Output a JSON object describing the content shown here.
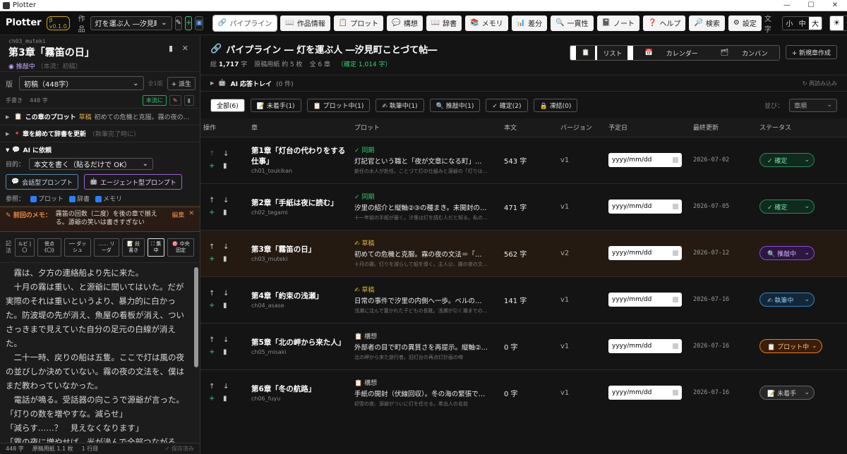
{
  "window": {
    "title": "Plotter",
    "min": "—",
    "max": "☐",
    "close": "✕"
  },
  "topbar": {
    "logo": "Plotter",
    "version": "β v0.1.0",
    "work_label": "作品",
    "work_value": "灯を運ぶ人 ―汐見町こ…",
    "tabs": [
      {
        "icon": "🔗",
        "label": "パイプライン"
      },
      {
        "icon": "📖",
        "label": "作品情報"
      },
      {
        "icon": "📋",
        "label": "プロット"
      },
      {
        "icon": "💬",
        "label": "構想"
      },
      {
        "icon": "📖",
        "label": "辞書"
      },
      {
        "icon": "📚",
        "label": "メモリ"
      },
      {
        "icon": "📊",
        "label": "差分"
      },
      {
        "icon": "🔍",
        "label": "一貫性"
      },
      {
        "icon": "📓",
        "label": "ノート"
      },
      {
        "icon": "❓",
        "label": "ヘルプ"
      },
      {
        "icon": "🔎",
        "label": "検索"
      },
      {
        "icon": "⚙",
        "label": "設定"
      }
    ],
    "font_label": "文字",
    "font_sizes": [
      "小",
      "中",
      "大"
    ]
  },
  "left": {
    "slug": "ch03_muteki",
    "title": "第3章「霧笛の日」",
    "status": "推敲中",
    "status_sub": "（本流：初稿）",
    "version_label": "版",
    "version_value": "初稿（448字）",
    "version_count": "全1版",
    "fork_button": "+ 派生",
    "wc_label": "手書き",
    "wc_value": "448 字",
    "mainline_button": "本流に",
    "plot_section": {
      "label": "この章のプロット",
      "state": "草稿",
      "desc": "初めての危機と克服。霧の夜の文…"
    },
    "dict_section": {
      "label": "章を締めて辞書を更新",
      "note": "（執筆完了時に）"
    },
    "ai": {
      "title": "AI に依頼",
      "purpose_label": "目的：",
      "purpose_value": "本文を書く（貼るだけで OK）",
      "chat_prompt": "会話型プロンプト",
      "agent_prompt": "エージェント型プロンプト",
      "refs_label": "参照：",
      "refs": [
        "プロット",
        "辞書",
        "メモリ"
      ]
    },
    "memo": {
      "label": "前回のメモ：",
      "text": "霧笛の回数（二度）を後の章で揃える。源爺の笑いは書きすぎない",
      "edit": "編集"
    },
    "tools": {
      "label": "記法",
      "buttons": [
        "ルビ |〇",
        "傍点《〇》",
        "── ダッシュ",
        "…… リーダ",
        "📝 段書き",
        "⛶ 集中",
        "🎯 中央固定"
      ]
    },
    "editor_lines": [
      "　霧は、夕方の連絡船より先に来た。",
      "　十月の霧は重い、と源爺に聞いてはいた。だが実際のそれは重いというより、暴力的に白かった。防波堤の先が消え、魚屋の看板が消え、ついさっきまで見えていた自分の足元の白線が消えた。",
      "　二十一時、戻りの船は五隻。ここで灯は風の夜の並びしか決めていない。霧の夜の文法を、僕はまだ教わっていなかった。",
      "　電話が鳴る。受話器の向こうで源爺が言った。",
      "「灯りの数を増やすな。減らせ」",
      "「減らす……？　見えなくなります」",
      "「霧の夜に増やせば、光が滲んで全部つながる。文章が読め"
    ],
    "footer": {
      "chars": "448 字",
      "paper": "原稿用紙 1.1 枚",
      "line": "1 行目",
      "saved": "✓ 保存済み"
    }
  },
  "pipeline": {
    "title": "パイプライン ― 灯を運ぶ人 ―汐見町ことづて帖―",
    "total_label": "総",
    "total_value": "1,717",
    "total_unit": "字",
    "paper": "原稿用紙 約 5 枚",
    "chapters": "全 6 章",
    "confirmed": "（確定 1,014 字）",
    "views": [
      {
        "icon": "📋",
        "label": "リスト"
      },
      {
        "icon": "📅",
        "label": "カレンダー"
      },
      {
        "icon": "🗂",
        "label": "カンバン"
      }
    ],
    "new_chapter": "+ 新規章作成",
    "tray_title": "AI 応答トレイ",
    "tray_count": "(0 件)",
    "tray_reload": "↻ 再読み込み",
    "filters": [
      "全部(6)",
      "📝 未着手(1)",
      "📋 プロット中(1)",
      "✍ 執筆中(1)",
      "🔍 推敲中(1)",
      "✓ 確定(2)",
      "🔒 凍結(0)"
    ],
    "sort_label": "並び：",
    "sort_value": "章順",
    "columns": [
      "操作",
      "章",
      "プロット",
      "本文",
      "バージョン",
      "予定日",
      "最終更新",
      "ステータス"
    ],
    "date_placeholder": "yyyy/mm/dd",
    "rows": [
      {
        "title": "第1章「灯台の代わりをする仕事」",
        "slug": "ch01_toukikan",
        "plot_state": "✓ 同期",
        "plot_main": "灯記官という職と「夜が文章になる町」の提示。源爺…",
        "plot_sub": "新任の水人が赴任。ことづて灯の仕組みと源爺の「灯りは文字だ」という教え",
        "chars": "543 字",
        "version": "v1",
        "updated": "2026-07-02",
        "status": "✓ 確定"
      },
      {
        "title": "第2章「手紙は夜に読む」",
        "slug": "ch02_tegami",
        "plot_state": "✓ 同期",
        "plot_main": "汐里の紹介と縦軸②③の種まき。未開封の手紙を…",
        "plot_sub": "十一年前の手紙が届く。汐里は灯を読む人だと知る。私の夜と名の一致",
        "chars": "471 字",
        "version": "v1",
        "updated": "2026-07-05",
        "status": "✓ 確定"
      },
      {
        "title": "第3章「霧笛の日」",
        "slug": "ch03_muteki",
        "plot_state": "✍ 草稿",
        "plot_main": "初めての危機と克服。霧の夜の文法＝「減らす」で源…",
        "plot_sub": "十月の霧。灯りを減らして船を導く。主人公、霧の夜の文法を覚える",
        "chars": "562 字",
        "version": "v2",
        "updated": "2026-07-12",
        "status": "🔍 推敲中"
      },
      {
        "title": "第4章「約束の浅瀬」",
        "slug": "ch04_asase",
        "plot_state": "✍ 草稿",
        "plot_main": "日常の事件で汐里の内側へ一歩。ベルの意味に触…",
        "plot_sub": "浅瀬に沈んで置かれた子どもの長靴。浅瀬が引く潮までの十一分",
        "chars": "141 字",
        "version": "v1",
        "updated": "2026-07-16",
        "status": "✍ 執筆中"
      },
      {
        "title": "第5章「北の岬から来た人」",
        "slug": "ch05_misaki",
        "plot_state": "📋 構想",
        "plot_main": "外部者の目で町の異質さを再提示。縦軸②を1滴",
        "plot_sub": "北の岬から来た旅行者。旧灯台の再点灯計画の噂",
        "chars": "0 字",
        "version": "v1",
        "updated": "2026-07-16",
        "status": "📋 プロット中"
      },
      {
        "title": "第6章「冬の航路」",
        "slug": "ch06_fuyu",
        "plot_state": "📋 構想",
        "plot_main": "手紙の開封（伏線回収）。冬の海の緊張で最終…",
        "plot_sub": "初雪の夜、源爺がついに灯を任せる。希出人の名前",
        "chars": "0 字",
        "version": "v1",
        "updated": "2026-07-16",
        "status": "📝 未着手"
      }
    ]
  }
}
